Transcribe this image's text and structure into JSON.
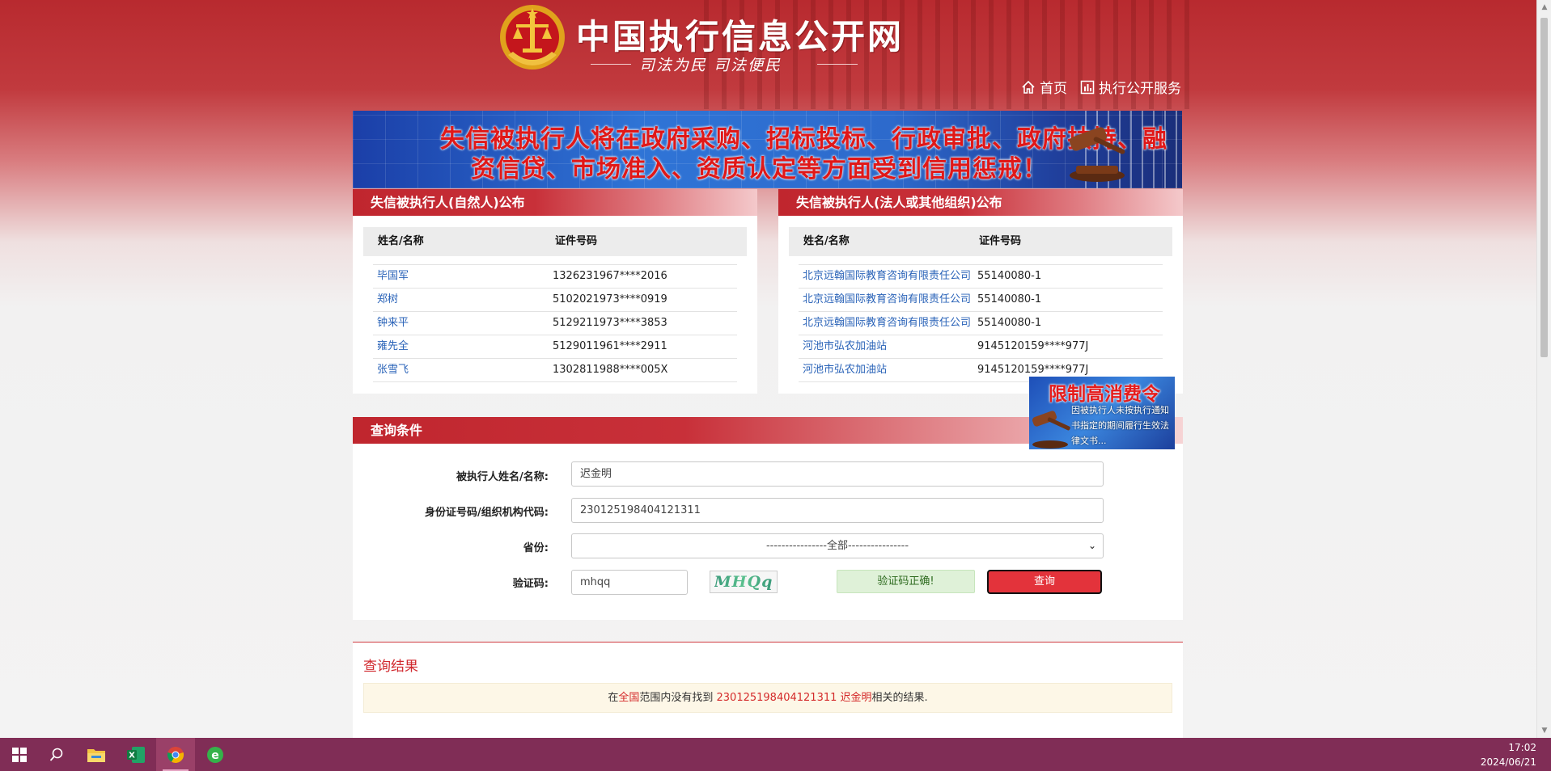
{
  "header": {
    "site_title": "中国执行信息公开网",
    "slogan": "司法为民    司法便民",
    "nav": [
      {
        "label": "首页",
        "icon": "home-icon"
      },
      {
        "label": "执行公开服务",
        "icon": "bar-chart-icon"
      }
    ]
  },
  "banner": {
    "line1": "失信被执行人将在政府采购、招标投标、行政审批、政府扶持、融",
    "line2": "资信贷、市场准入、资质认定等方面受到信用惩戒！"
  },
  "natural_panel": {
    "title": "失信被执行人(自然人)公布",
    "col_name": "姓名/名称",
    "col_id": "证件号码",
    "rows": [
      {
        "name": "毕国军",
        "id": "1326231967****2016"
      },
      {
        "name": "郑树",
        "id": "5102021973****0919"
      },
      {
        "name": "钟来平",
        "id": "5129211973****3853"
      },
      {
        "name": "雍先全",
        "id": "5129011961****2911"
      },
      {
        "name": "张雪飞",
        "id": "1302811988****005X"
      }
    ]
  },
  "legal_panel": {
    "title": "失信被执行人(法人或其他组织)公布",
    "col_name": "姓名/名称",
    "col_id": "证件号码",
    "rows": [
      {
        "name": "北京远翰国际教育咨询有限责任公司",
        "id": "55140080-1"
      },
      {
        "name": "北京远翰国际教育咨询有限责任公司",
        "id": "55140080-1"
      },
      {
        "name": "北京远翰国际教育咨询有限责任公司",
        "id": "55140080-1"
      },
      {
        "name": "河池市弘农加油站",
        "id": "9145120159****977J"
      },
      {
        "name": "河池市弘农加油站",
        "id": "9145120159****977J"
      }
    ]
  },
  "promo": {
    "title": "限制高消费令",
    "desc": "因被执行人未按执行通知书指定的期间履行生效法律文书..."
  },
  "query": {
    "title": "查询条件",
    "name_label": "被执行人姓名/名称:",
    "name_value": "迟金明",
    "id_label": "身份证号码/组织机构代码:",
    "id_value": "230125198404121311",
    "province_label": "省份:",
    "province_value": "----------------全部----------------",
    "captcha_label": "验证码:",
    "captcha_value": "mhqq",
    "captcha_image_text": "MHQq",
    "captcha_status": "验证码正确!",
    "search_button": "查询"
  },
  "results": {
    "title": "查询结果",
    "msg_prefix": "在",
    "msg_scope": "全国",
    "msg_mid": "范围内没有找到 ",
    "msg_id": "230125198404121311",
    "msg_name": " 迟金明",
    "msg_suffix": "相关的结果."
  },
  "taskbar": {
    "apps": [
      "windows-start-icon",
      "search-icon",
      "file-explorer-icon",
      "excel-icon",
      "chrome-icon",
      "browser-e-icon"
    ],
    "time": "17:02",
    "date": "2024/06/21"
  },
  "colors": {
    "brand_red": "#c0262e",
    "link_blue": "#2a63b8",
    "taskbar": "#802d56"
  }
}
